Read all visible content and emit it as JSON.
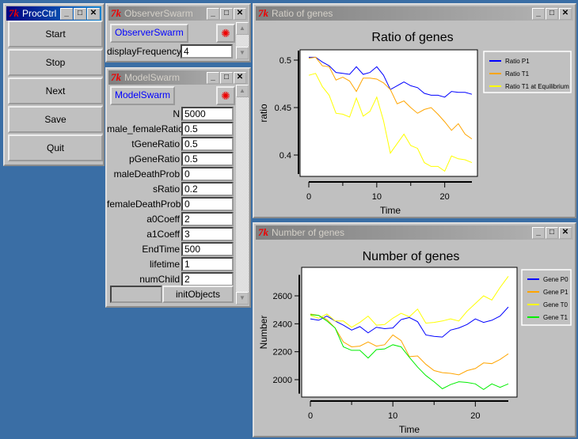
{
  "procctrl": {
    "title": "ProcCtrl",
    "buttons": [
      "Start",
      "Stop",
      "Next",
      "Save",
      "Quit"
    ]
  },
  "observer": {
    "title": "ObserverSwarm",
    "button": "ObserverSwarm",
    "field_label": "displayFrequency",
    "field_value": "4"
  },
  "model": {
    "title": "ModelSwarm",
    "button": "ModelSwarm",
    "init_button": "initObjects",
    "fields": [
      {
        "label": "N",
        "value": "5000"
      },
      {
        "label": "male_femaleRatio",
        "value": "0.5"
      },
      {
        "label": "tGeneRatio",
        "value": "0.5"
      },
      {
        "label": "pGeneRatio",
        "value": "0.5"
      },
      {
        "label": "maleDeathProb",
        "value": "0"
      },
      {
        "label": "sRatio",
        "value": "0.2"
      },
      {
        "label": "femaleDeathProb",
        "value": "0"
      },
      {
        "label": "a0Coeff",
        "value": "2"
      },
      {
        "label": "a1Coeff",
        "value": "3"
      },
      {
        "label": "EndTime",
        "value": "500"
      },
      {
        "label": "lifetime",
        "value": "1"
      },
      {
        "label": "numChild",
        "value": "2"
      }
    ]
  },
  "window_buttons": {
    "minimize": "_",
    "maximize": "□",
    "close": "✕"
  },
  "icons": {
    "app": "tk-feather-icon",
    "drop": "bug-icon"
  },
  "chart_data": [
    {
      "window_title": "Ratio of genes",
      "type": "line",
      "title": "Ratio of genes",
      "xlabel": "Time",
      "ylabel": "ratio",
      "xticks": [
        0,
        10,
        20
      ],
      "yticks": [
        0.4,
        0.45,
        0.5
      ],
      "ytick_labels": [
        "0.4",
        "0.45",
        "0.5"
      ],
      "xlim": [
        0,
        24
      ],
      "ylim": [
        0.38,
        0.51
      ],
      "legend": "right",
      "grid": false,
      "x": [
        0,
        1,
        2,
        3,
        4,
        5,
        6,
        7,
        8,
        9,
        10,
        11,
        12,
        13,
        14,
        15,
        16,
        17,
        18,
        19,
        20,
        21,
        22,
        23,
        24
      ],
      "series": [
        {
          "name": "Ratio P1",
          "color": "#0000ff",
          "values": [
            0.503,
            0.503,
            0.498,
            0.494,
            0.487,
            0.486,
            0.485,
            0.493,
            0.485,
            0.487,
            0.493,
            0.484,
            0.469,
            0.473,
            0.477,
            0.473,
            0.471,
            0.465,
            0.463,
            0.463,
            0.461,
            0.467,
            0.466,
            0.466,
            0.464
          ]
        },
        {
          "name": "Ratio T1",
          "color": "#ffa500",
          "values": [
            0.502,
            0.503,
            0.494,
            0.493,
            0.479,
            0.482,
            0.478,
            0.467,
            0.481,
            0.481,
            0.48,
            0.476,
            0.469,
            0.454,
            0.457,
            0.45,
            0.444,
            0.448,
            0.45,
            0.443,
            0.435,
            0.426,
            0.433,
            0.422,
            0.417
          ]
        },
        {
          "name": "Ratio T1 at Equilibrium",
          "color": "#ffff00",
          "values": [
            0.484,
            0.486,
            0.472,
            0.463,
            0.444,
            0.443,
            0.44,
            0.46,
            0.441,
            0.446,
            0.461,
            0.436,
            0.402,
            0.412,
            0.422,
            0.41,
            0.407,
            0.392,
            0.388,
            0.388,
            0.383,
            0.399,
            0.396,
            0.395,
            0.392
          ]
        }
      ]
    },
    {
      "window_title": "Number of genes",
      "type": "line",
      "title": "Number of genes",
      "xlabel": "Time",
      "ylabel": "Number",
      "xticks": [
        0,
        10,
        20
      ],
      "yticks": [
        2000,
        2200,
        2400,
        2600
      ],
      "ytick_labels": [
        "2000",
        "2200",
        "2400",
        "2600"
      ],
      "xlim": [
        0,
        24
      ],
      "ylim": [
        1900,
        2750
      ],
      "legend": "right",
      "grid": false,
      "x": [
        0,
        1,
        2,
        3,
        4,
        5,
        6,
        7,
        8,
        9,
        10,
        11,
        12,
        13,
        14,
        15,
        16,
        17,
        18,
        19,
        20,
        21,
        22,
        23,
        24
      ],
      "series": [
        {
          "name": "Gene P0",
          "color": "#0000ff",
          "values": [
            2435,
            2425,
            2455,
            2420,
            2390,
            2355,
            2380,
            2335,
            2375,
            2365,
            2370,
            2430,
            2445,
            2415,
            2320,
            2310,
            2305,
            2355,
            2370,
            2395,
            2435,
            2410,
            2425,
            2455,
            2520
          ]
        },
        {
          "name": "Gene P1",
          "color": "#ffa500",
          "values": [
            2470,
            2460,
            2430,
            2370,
            2270,
            2235,
            2240,
            2270,
            2240,
            2250,
            2320,
            2280,
            2165,
            2170,
            2110,
            2065,
            2050,
            2045,
            2035,
            2065,
            2080,
            2120,
            2115,
            2145,
            2185
          ]
        },
        {
          "name": "Gene T0",
          "color": "#ffff00",
          "values": [
            2460,
            2440,
            2470,
            2420,
            2420,
            2375,
            2410,
            2455,
            2390,
            2395,
            2440,
            2475,
            2450,
            2505,
            2405,
            2410,
            2420,
            2435,
            2420,
            2490,
            2545,
            2600,
            2570,
            2660,
            2740
          ]
        },
        {
          "name": "Gene T1",
          "color": "#00ee00",
          "values": [
            2465,
            2460,
            2420,
            2370,
            2235,
            2210,
            2210,
            2155,
            2215,
            2220,
            2250,
            2235,
            2160,
            2090,
            2030,
            1985,
            1935,
            1965,
            1985,
            1980,
            1970,
            1930,
            1970,
            1945,
            1970
          ]
        }
      ]
    }
  ]
}
